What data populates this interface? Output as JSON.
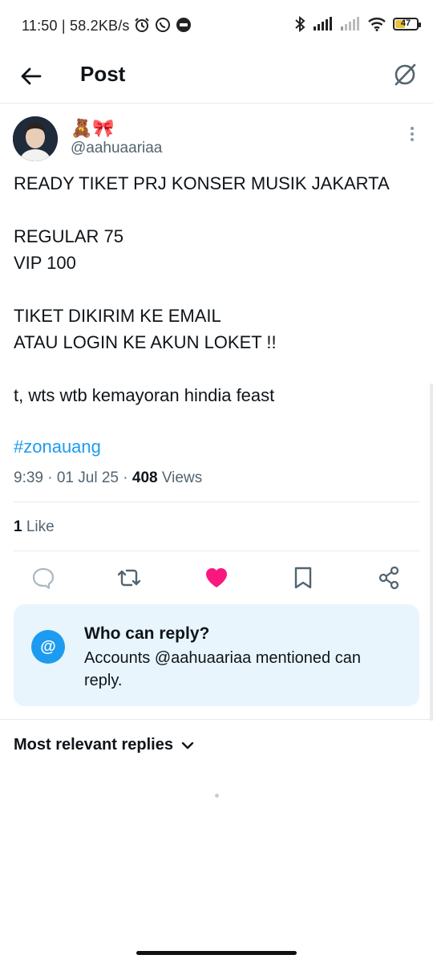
{
  "status_bar": {
    "time_speed": "11:50 | 58.2KB/s",
    "battery_level": "47",
    "left_icons": [
      "alarm-icon",
      "whatsapp-icon",
      "message-icon"
    ],
    "right_icons": [
      "bluetooth-icon",
      "signal-icon",
      "signal-icon",
      "wifi-icon",
      "battery-icon"
    ]
  },
  "header": {
    "title": "Post",
    "back_icon": "arrow-left-icon",
    "grok_icon": "grok-icon"
  },
  "post": {
    "display_name": "🧸🎀",
    "handle": "@aahuaariaa",
    "lines": [
      "READY TIKET PRJ KONSER MUSIK JAKARTA",
      "REGULAR 75",
      "VIP 100",
      "TIKET DIKIRIM KE EMAIL",
      "ATAU LOGIN KE AKUN LOKET !!",
      "t, wts wtb kemayoran hindia feast"
    ],
    "hashtag": "#zonauang",
    "timestamp": "9:39 · 01 Jul 25 · ",
    "views_count": "408",
    "views_label": " Views",
    "likes_count": "1",
    "likes_label": " Like"
  },
  "actions": [
    {
      "name": "reply",
      "icon": "reply-icon"
    },
    {
      "name": "repost",
      "icon": "repost-icon"
    },
    {
      "name": "like",
      "icon": "heart-icon",
      "active_color": "#f91880"
    },
    {
      "name": "bookmark",
      "icon": "bookmark-icon"
    },
    {
      "name": "share",
      "icon": "share-icon"
    }
  ],
  "reply_card": {
    "badge": "@",
    "title": "Who can reply?",
    "description": "Accounts @aahuaariaa mentioned can reply."
  },
  "replies": {
    "sort_label": "Most relevant replies"
  },
  "colors": {
    "accent": "#1d9bf0",
    "like": "#f91880",
    "muted": "#536471",
    "card_bg": "#e8f5fd"
  }
}
